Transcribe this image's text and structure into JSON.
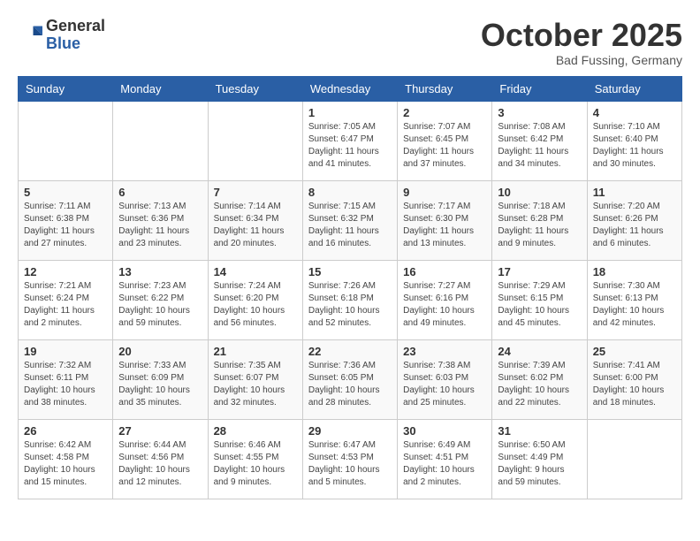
{
  "header": {
    "logo_general": "General",
    "logo_blue": "Blue",
    "month": "October 2025",
    "location": "Bad Fussing, Germany"
  },
  "weekdays": [
    "Sunday",
    "Monday",
    "Tuesday",
    "Wednesday",
    "Thursday",
    "Friday",
    "Saturday"
  ],
  "weeks": [
    [
      {
        "day": "",
        "info": ""
      },
      {
        "day": "",
        "info": ""
      },
      {
        "day": "",
        "info": ""
      },
      {
        "day": "1",
        "info": "Sunrise: 7:05 AM\nSunset: 6:47 PM\nDaylight: 11 hours\nand 41 minutes."
      },
      {
        "day": "2",
        "info": "Sunrise: 7:07 AM\nSunset: 6:45 PM\nDaylight: 11 hours\nand 37 minutes."
      },
      {
        "day": "3",
        "info": "Sunrise: 7:08 AM\nSunset: 6:42 PM\nDaylight: 11 hours\nand 34 minutes."
      },
      {
        "day": "4",
        "info": "Sunrise: 7:10 AM\nSunset: 6:40 PM\nDaylight: 11 hours\nand 30 minutes."
      }
    ],
    [
      {
        "day": "5",
        "info": "Sunrise: 7:11 AM\nSunset: 6:38 PM\nDaylight: 11 hours\nand 27 minutes."
      },
      {
        "day": "6",
        "info": "Sunrise: 7:13 AM\nSunset: 6:36 PM\nDaylight: 11 hours\nand 23 minutes."
      },
      {
        "day": "7",
        "info": "Sunrise: 7:14 AM\nSunset: 6:34 PM\nDaylight: 11 hours\nand 20 minutes."
      },
      {
        "day": "8",
        "info": "Sunrise: 7:15 AM\nSunset: 6:32 PM\nDaylight: 11 hours\nand 16 minutes."
      },
      {
        "day": "9",
        "info": "Sunrise: 7:17 AM\nSunset: 6:30 PM\nDaylight: 11 hours\nand 13 minutes."
      },
      {
        "day": "10",
        "info": "Sunrise: 7:18 AM\nSunset: 6:28 PM\nDaylight: 11 hours\nand 9 minutes."
      },
      {
        "day": "11",
        "info": "Sunrise: 7:20 AM\nSunset: 6:26 PM\nDaylight: 11 hours\nand 6 minutes."
      }
    ],
    [
      {
        "day": "12",
        "info": "Sunrise: 7:21 AM\nSunset: 6:24 PM\nDaylight: 11 hours\nand 2 minutes."
      },
      {
        "day": "13",
        "info": "Sunrise: 7:23 AM\nSunset: 6:22 PM\nDaylight: 10 hours\nand 59 minutes."
      },
      {
        "day": "14",
        "info": "Sunrise: 7:24 AM\nSunset: 6:20 PM\nDaylight: 10 hours\nand 56 minutes."
      },
      {
        "day": "15",
        "info": "Sunrise: 7:26 AM\nSunset: 6:18 PM\nDaylight: 10 hours\nand 52 minutes."
      },
      {
        "day": "16",
        "info": "Sunrise: 7:27 AM\nSunset: 6:16 PM\nDaylight: 10 hours\nand 49 minutes."
      },
      {
        "day": "17",
        "info": "Sunrise: 7:29 AM\nSunset: 6:15 PM\nDaylight: 10 hours\nand 45 minutes."
      },
      {
        "day": "18",
        "info": "Sunrise: 7:30 AM\nSunset: 6:13 PM\nDaylight: 10 hours\nand 42 minutes."
      }
    ],
    [
      {
        "day": "19",
        "info": "Sunrise: 7:32 AM\nSunset: 6:11 PM\nDaylight: 10 hours\nand 38 minutes."
      },
      {
        "day": "20",
        "info": "Sunrise: 7:33 AM\nSunset: 6:09 PM\nDaylight: 10 hours\nand 35 minutes."
      },
      {
        "day": "21",
        "info": "Sunrise: 7:35 AM\nSunset: 6:07 PM\nDaylight: 10 hours\nand 32 minutes."
      },
      {
        "day": "22",
        "info": "Sunrise: 7:36 AM\nSunset: 6:05 PM\nDaylight: 10 hours\nand 28 minutes."
      },
      {
        "day": "23",
        "info": "Sunrise: 7:38 AM\nSunset: 6:03 PM\nDaylight: 10 hours\nand 25 minutes."
      },
      {
        "day": "24",
        "info": "Sunrise: 7:39 AM\nSunset: 6:02 PM\nDaylight: 10 hours\nand 22 minutes."
      },
      {
        "day": "25",
        "info": "Sunrise: 7:41 AM\nSunset: 6:00 PM\nDaylight: 10 hours\nand 18 minutes."
      }
    ],
    [
      {
        "day": "26",
        "info": "Sunrise: 6:42 AM\nSunset: 4:58 PM\nDaylight: 10 hours\nand 15 minutes."
      },
      {
        "day": "27",
        "info": "Sunrise: 6:44 AM\nSunset: 4:56 PM\nDaylight: 10 hours\nand 12 minutes."
      },
      {
        "day": "28",
        "info": "Sunrise: 6:46 AM\nSunset: 4:55 PM\nDaylight: 10 hours\nand 9 minutes."
      },
      {
        "day": "29",
        "info": "Sunrise: 6:47 AM\nSunset: 4:53 PM\nDaylight: 10 hours\nand 5 minutes."
      },
      {
        "day": "30",
        "info": "Sunrise: 6:49 AM\nSunset: 4:51 PM\nDaylight: 10 hours\nand 2 minutes."
      },
      {
        "day": "31",
        "info": "Sunrise: 6:50 AM\nSunset: 4:49 PM\nDaylight: 9 hours\nand 59 minutes."
      },
      {
        "day": "",
        "info": ""
      }
    ]
  ]
}
